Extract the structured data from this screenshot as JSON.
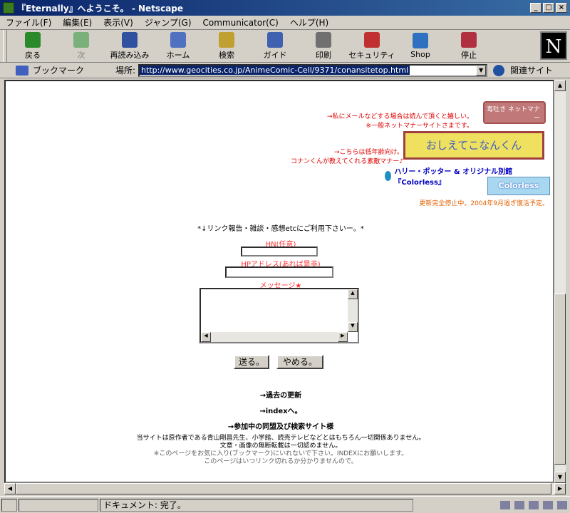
{
  "window": {
    "title": "『Eternally』へようこそ。 - Netscape",
    "buttons": [
      "_",
      "□",
      "×"
    ]
  },
  "menu": [
    "ファイル(F)",
    "編集(E)",
    "表示(V)",
    "ジャンプ(G)",
    "Communicator(C)",
    "ヘルプ(H)"
  ],
  "toolbar": [
    {
      "label": "戻る",
      "icon": "back-icon",
      "color": "#2a8a2a"
    },
    {
      "label": "次",
      "icon": "forward-icon",
      "color": "#7ab07a"
    },
    {
      "label": "再読み込み",
      "icon": "reload-icon",
      "color": "#3050a0"
    },
    {
      "label": "ホーム",
      "icon": "home-icon",
      "color": "#5070c0"
    },
    {
      "label": "検索",
      "icon": "search-icon",
      "color": "#c0a030"
    },
    {
      "label": "ガイド",
      "icon": "guide-icon",
      "color": "#4060b0"
    },
    {
      "label": "印刷",
      "icon": "print-icon",
      "color": "#707070"
    },
    {
      "label": "セキュリティ",
      "icon": "lock-icon",
      "color": "#c03030"
    },
    {
      "label": "Shop",
      "icon": "shop-icon",
      "color": "#3070c0"
    },
    {
      "label": "停止",
      "icon": "stop-icon",
      "color": "#b03040"
    }
  ],
  "logo": "N",
  "location": {
    "bookmarks_label": "ブックマーク",
    "location_label": "場所:",
    "url": "http://www.geocities.co.jp/AnimeComic-Cell/9371/conansitetop.html",
    "related_label": "関連サイト"
  },
  "page": {
    "note1_line1": "→私にメールなどする場合は読んで頂くと嬉しい。",
    "note1_line2": "※一般ネットマナーサイトさまです。",
    "banner1": "毒吐き ネットマナー",
    "note2_line1": "→こちらは低年齢向け。",
    "note2_line2": "コナンくんが教えてくれる素敵マナー♪",
    "banner2": "おしえてこなんくん",
    "harry_link": "ハリー・ポッター & オリジナル別館『Colorless』",
    "banner3": "Colorless",
    "stop_note": "更新完全停止中。2004年9月過ぎ復活予定。",
    "form_intro": "*↓リンク報告・雑談・感想etcにご利用下さいー。*",
    "hn_label": "HN(任意)",
    "hp_label": "HPアドレス(あれば是非)",
    "msg_label": "メッセージ★",
    "send_btn": "送る。",
    "cancel_btn": "やめる。",
    "link_past": "→過去の更新",
    "link_index": "→indexへ。",
    "link_join": "→参加中の同盟及び検索サイト様",
    "notes": [
      "当サイトは原作者である青山剛昌先生、小学館、読売テレビなどとはもちろん一切関係ありません。",
      "文章・画像の無断転載は一切認めません。",
      "※このページをお気に入り(ブックマーク)にいれないで下さい。INDEXにお願いします。",
      "このページはいつリンク切れるか分かりませんので。"
    ]
  },
  "status": {
    "text": "ドキュメント: 完了。"
  }
}
